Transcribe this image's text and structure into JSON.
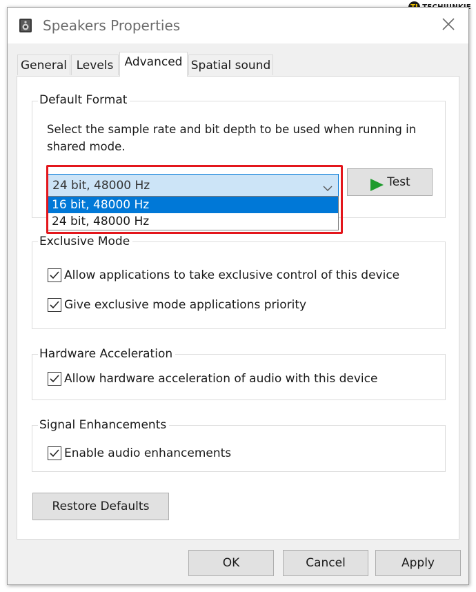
{
  "watermark": {
    "badge": "TJ",
    "text": "TECHJUNKIE"
  },
  "window": {
    "title": "Speakers Properties"
  },
  "icons": {
    "app": "speaker-icon",
    "close": "close-icon",
    "play": "play-icon",
    "chevron": "chevron-down-icon"
  },
  "tabs": [
    {
      "label": "General",
      "active": false
    },
    {
      "label": "Levels",
      "active": false
    },
    {
      "label": "Advanced",
      "active": true
    },
    {
      "label": "Spatial sound",
      "active": false
    }
  ],
  "default_format": {
    "legend": "Default Format",
    "description_line1": "Select the sample rate and bit depth to be used when running in",
    "description_line2": "shared mode.",
    "selected": "24 bit, 48000 Hz",
    "options": [
      "16 bit, 48000 Hz",
      "24 bit, 48000 Hz"
    ],
    "highlighted_option": "16 bit, 48000 Hz",
    "test_label": "Test"
  },
  "exclusive_mode": {
    "legend": "Exclusive Mode",
    "checkboxes": [
      {
        "label": "Allow applications to take exclusive control of this device",
        "checked": true
      },
      {
        "label": "Give exclusive mode applications priority",
        "checked": true
      }
    ]
  },
  "hardware_acceleration": {
    "legend": "Hardware Acceleration",
    "checkbox": {
      "label": "Allow hardware acceleration of audio with this device",
      "checked": true
    }
  },
  "signal_enhancements": {
    "legend": "Signal Enhancements",
    "checkbox": {
      "label": "Enable audio enhancements",
      "checked": true
    }
  },
  "buttons": {
    "restore_defaults": "Restore Defaults",
    "ok": "OK",
    "cancel": "Cancel",
    "apply": "Apply"
  },
  "colors": {
    "accent": "#0078d7",
    "callout": "#e3161c",
    "play": "#1e9b2d"
  }
}
